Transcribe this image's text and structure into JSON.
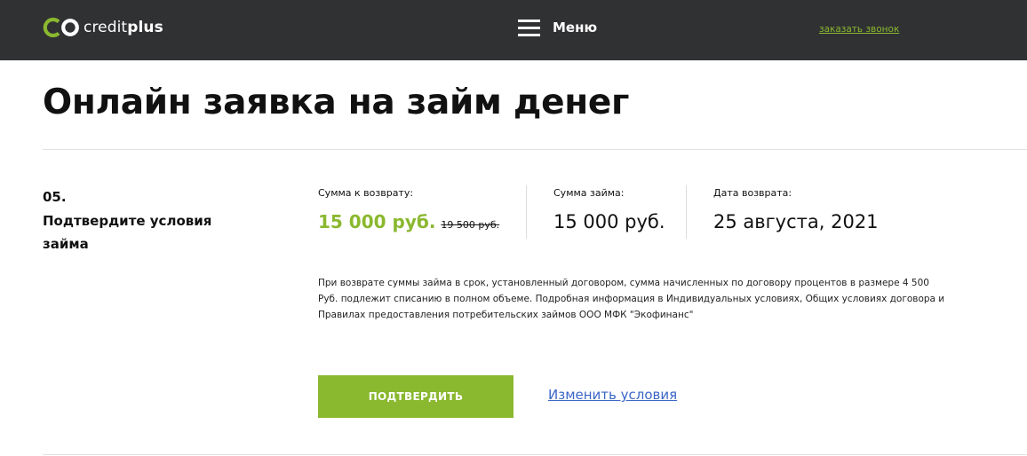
{
  "header": {
    "logo": {
      "text_light": "credit",
      "text_bold": "plus",
      "icon": "creditplus-logo-icon",
      "accent_color": "#8ab82f"
    },
    "menu_label": "Меню",
    "menu_icon": "hamburger-icon",
    "callback_link": "заказать звонок",
    "background_color": "#303133"
  },
  "page": {
    "title": "Онлайн заявка на займ денег"
  },
  "step": {
    "number": "05.",
    "title": "Подтвердите условия займа"
  },
  "summary": {
    "repay": {
      "label": "Сумма к возврату:",
      "amount": "15 000 руб.",
      "old_amount": "19 500 руб."
    },
    "loan": {
      "label": "Сумма займа:",
      "amount": "15 000 руб."
    },
    "date": {
      "label": "Дата возврата:",
      "value": "25 августа, 2021"
    }
  },
  "disclaimer": "При возврате суммы займа в срок, установленный договором, сумма начисленных по договору процентов в размере 4 500 Руб. подлежит списанию в полном объеме. Подробная информация в Индивидуальных условиях, Общих условиях договора и Правилах предоставления потребительских займов ООО МФК \"Экофинанс\"",
  "actions": {
    "confirm_label": "ПОДТВЕРДИТЬ",
    "change_label": "Изменить условия",
    "confirm_color": "#8ab82f",
    "link_color": "#3b66c7"
  }
}
